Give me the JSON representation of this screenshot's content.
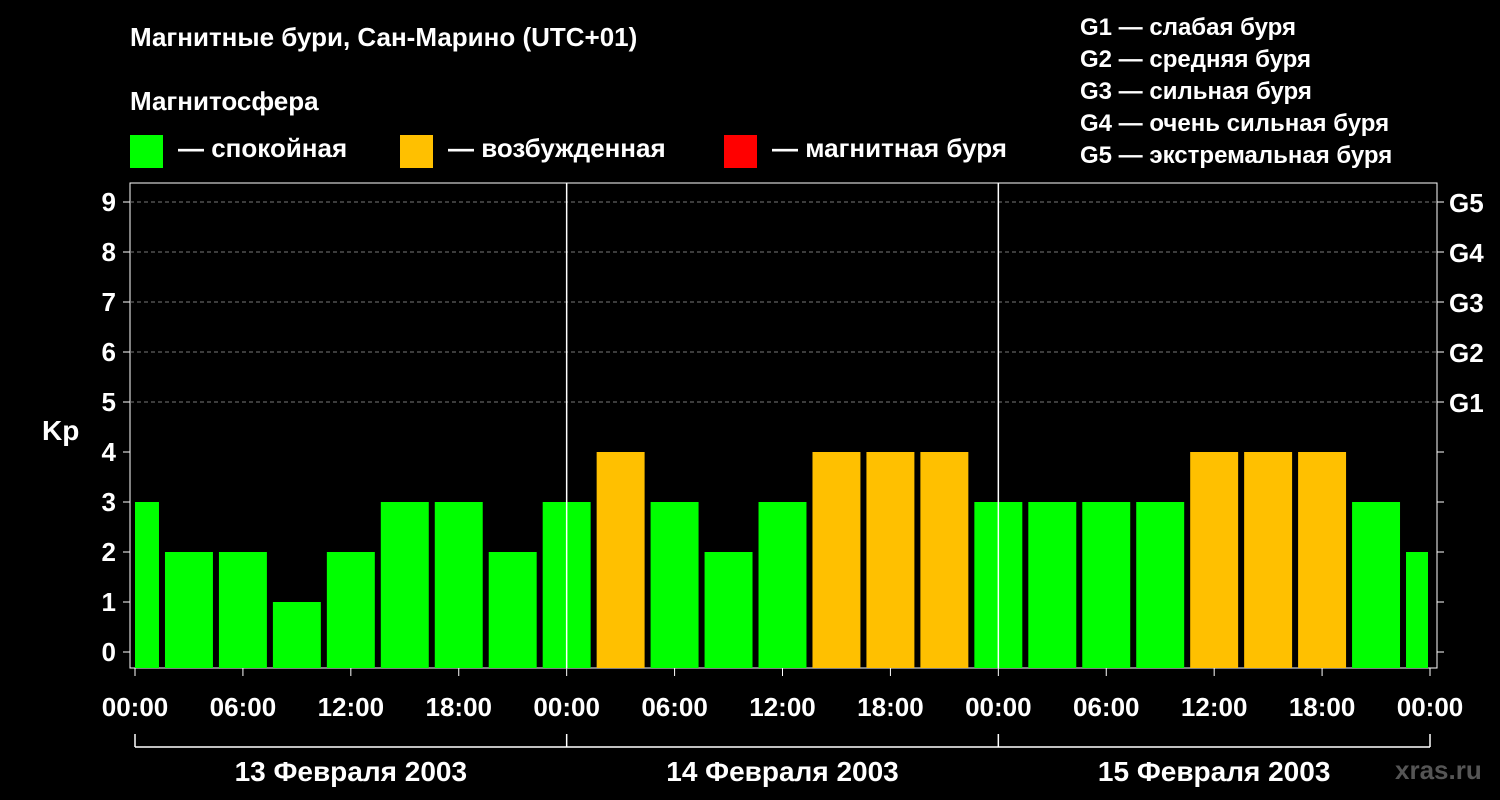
{
  "title": "Магнитные бури, Сан-Марино (UTC+01)",
  "subtitle": "Магнитосфера",
  "legend": [
    {
      "label": "— спокойная",
      "color": "#00ff00"
    },
    {
      "label": "— возбужденная",
      "color": "#ffc000"
    },
    {
      "label": "— магнитная буря",
      "color": "#ff0000"
    }
  ],
  "g_legend": [
    "G1 — слабая буря",
    "G2 — средняя буря",
    "G3 — сильная буря",
    "G4 — очень сильная буря",
    "G5 — экстремальная буря"
  ],
  "watermark": "xras.ru",
  "chart_data": {
    "type": "bar",
    "ylabel": "Kp",
    "ylim": [
      0,
      9
    ],
    "y_ticks": [
      "0",
      "1",
      "2",
      "3",
      "4",
      "5",
      "6",
      "7",
      "8",
      "9"
    ],
    "g_ticks": [
      {
        "kp": 5,
        "label": "G1"
      },
      {
        "kp": 6,
        "label": "G2"
      },
      {
        "kp": 7,
        "label": "G3"
      },
      {
        "kp": 8,
        "label": "G4"
      },
      {
        "kp": 9,
        "label": "G5"
      }
    ],
    "x_tick_labels": [
      "00:00",
      "06:00",
      "12:00",
      "18:00",
      "00:00",
      "06:00",
      "12:00",
      "18:00",
      "00:00",
      "06:00",
      "12:00",
      "18:00",
      "00:00"
    ],
    "days": [
      "13 Февраля 2003",
      "14 Февраля 2003",
      "15 Февраля 2003"
    ],
    "grid": "dashed, at Kp 5–9",
    "thresholds": {
      "disturbed": 4,
      "storm": 5
    },
    "colors": {
      "quiet": "#00ff00",
      "disturbed": "#ffc000",
      "storm": "#ff0000"
    },
    "values": [
      3,
      2,
      2,
      1,
      2,
      3,
      3,
      2,
      3,
      4,
      3,
      2,
      3,
      4,
      4,
      4,
      3,
      3,
      3,
      3,
      4,
      4,
      4,
      3,
      2
    ]
  }
}
